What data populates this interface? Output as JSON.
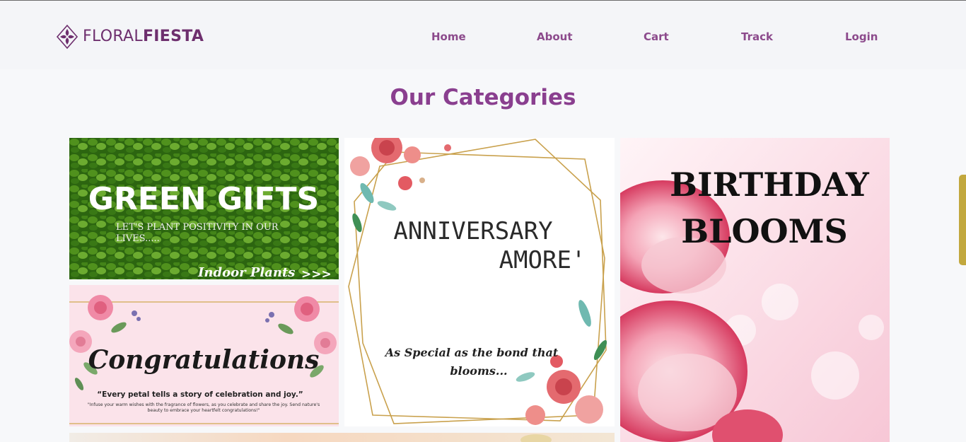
{
  "brand": {
    "part1": "FLORAL",
    "part2": "FIESTA",
    "icon": "flower-diamond-icon"
  },
  "nav": {
    "home": "Home",
    "about": "About",
    "cart": "Cart",
    "track": "Track",
    "login": "Login"
  },
  "page": {
    "heading": "Our Categories"
  },
  "colors": {
    "brand": "#6e2f6e",
    "nav": "#8c4a8c",
    "heading": "#8a3f8f",
    "scrollbar": "#c2a83e"
  },
  "categories": {
    "green": {
      "title": "GREEN GIFTS",
      "tagline_1": "LET'S PLANT POSITIVITY IN OUR",
      "tagline_2": "LIVES.....",
      "link": "Indoor Plants",
      "arrows": ">>>"
    },
    "congrats": {
      "title": "Congratulations",
      "quote": "“Every petal tells a story of celebration and joy.”",
      "small_1": "\"Infuse your warm wishes with the fragrance of flowers, as you celebrate and share the joy. Send nature's",
      "small_2": "beauty to embrace your heartfelt congratulations!\""
    },
    "anniversary": {
      "title_1": "ANNIVERSARY",
      "title_2": "AMORE'",
      "tagline_1": "As Special as the bond that",
      "tagline_2": "blooms..."
    },
    "birthday": {
      "title_1": "BIRTHDAY",
      "title_2": "BLOOMS"
    }
  }
}
